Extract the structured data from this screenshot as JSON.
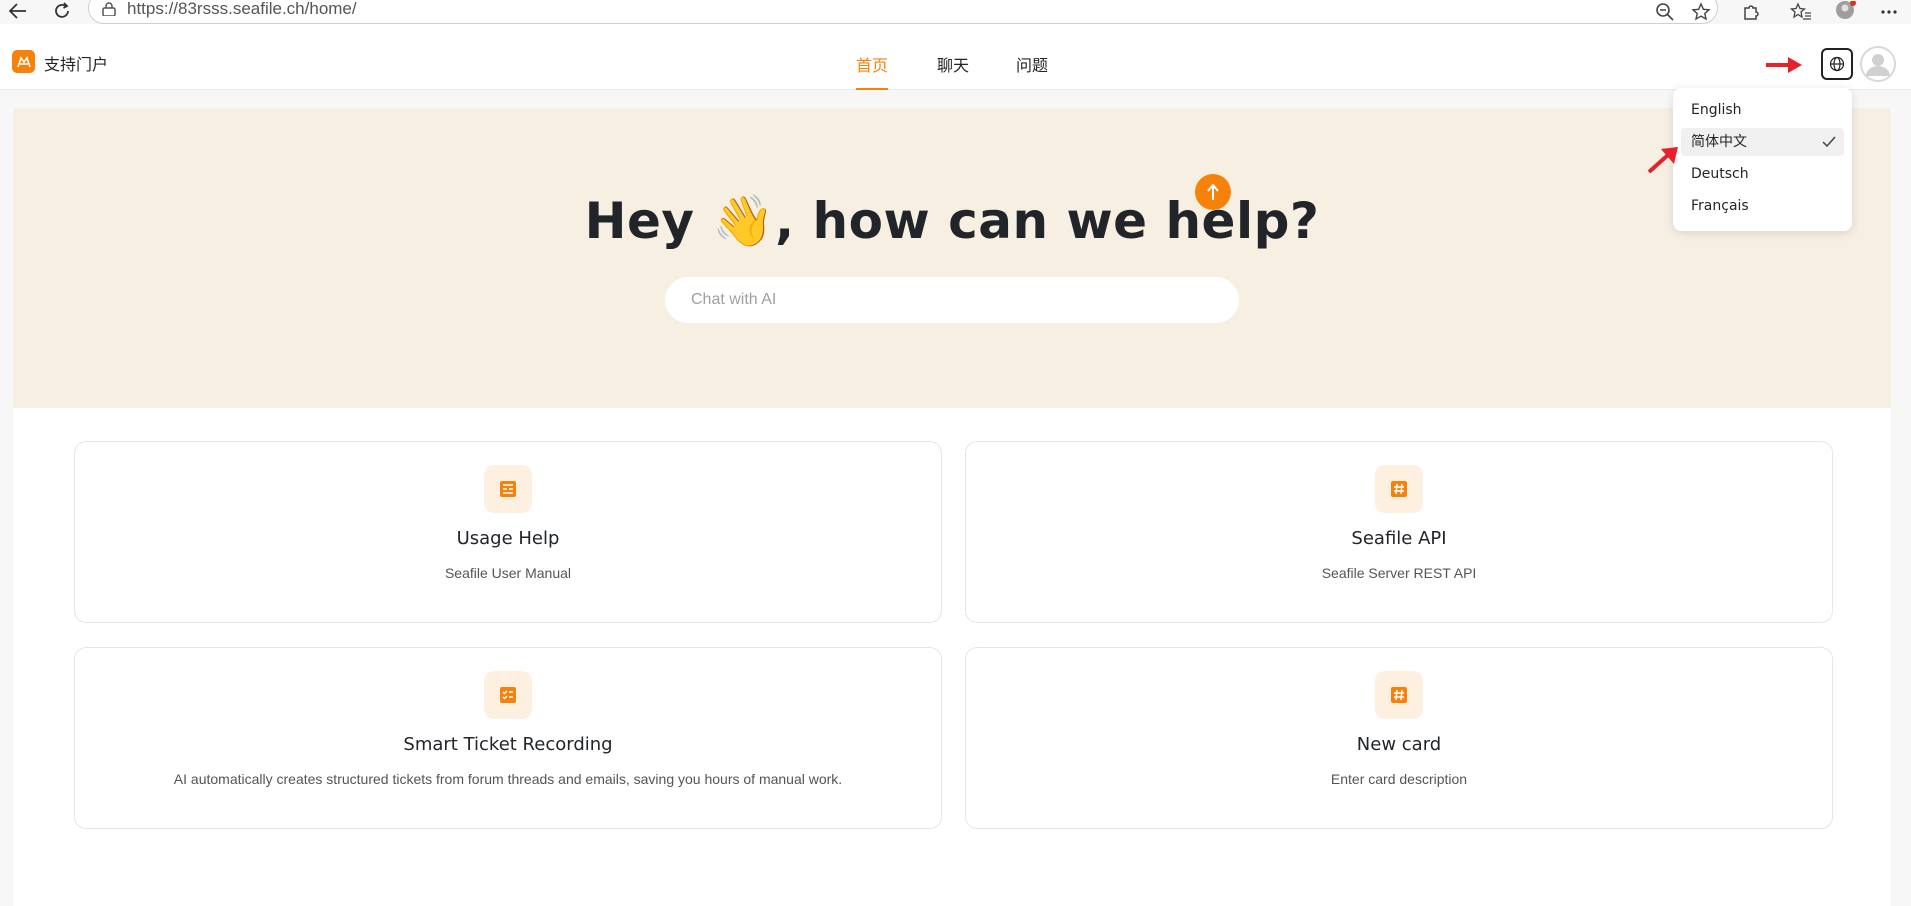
{
  "browser": {
    "url": "https://83rsss.seafile.ch/home/"
  },
  "header": {
    "brand": "支持门户",
    "tabs": [
      {
        "label": "首页",
        "active": true
      },
      {
        "label": "聊天",
        "active": false
      },
      {
        "label": "问题",
        "active": false
      }
    ]
  },
  "hero": {
    "title_part1": "Hey ",
    "emoji": "👋",
    "title_part2": ", how can we help?",
    "search_placeholder": "Chat with AI"
  },
  "cards": [
    {
      "title": "Usage Help",
      "description": "Seafile User Manual",
      "icon": "document-list-icon"
    },
    {
      "title": "Seafile API",
      "description": "Seafile Server REST API",
      "icon": "hash-icon"
    },
    {
      "title": "Smart Ticket Recording",
      "description": "AI automatically creates structured tickets from forum threads and emails, saving you hours of manual work.",
      "icon": "checklist-icon"
    },
    {
      "title": "New card",
      "description": "Enter card description",
      "icon": "hash-icon"
    }
  ],
  "language_menu": {
    "items": [
      {
        "label": "English",
        "selected": false
      },
      {
        "label": "简体中文",
        "selected": true
      },
      {
        "label": "Deutsch",
        "selected": false
      },
      {
        "label": "Français",
        "selected": false
      }
    ]
  },
  "colors": {
    "accent": "#f6820c",
    "hero_bg": "#f8efe3",
    "annotation_arrow": "#e5212b"
  }
}
